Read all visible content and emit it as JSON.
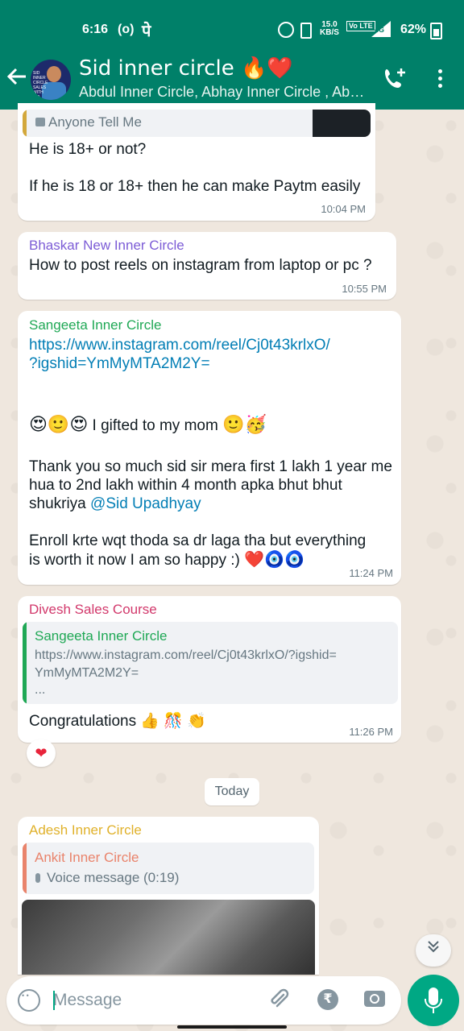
{
  "status_bar": {
    "time": "6:16",
    "record_indicator": "(o)",
    "pe_glyph": "पे",
    "speed": "15.0",
    "speed_unit": "KB/S",
    "volte": "Vo LTE",
    "network": "4G",
    "battery": "62%"
  },
  "header": {
    "title": "Sid inner circle 🔥❤️",
    "subtitle": "Abdul Inner Circle, Abhay Inner Circle , Abhi...",
    "avatar_text": "SID INNER CIRCLE SALES WITH SID"
  },
  "messages": [
    {
      "quote_text": "Anyone Tell Me",
      "lines": [
        "He is 18+ or not?",
        "If he is 18 or 18+ then he can make Paytm easily"
      ],
      "time": "10:04 PM"
    },
    {
      "sender": "Bhaskar New Inner Circle",
      "sender_color": "#7c5cd6",
      "text": "How to post reels on instagram from laptop or pc ?",
      "time": "10:55 PM"
    },
    {
      "sender": "Sangeeta  Inner Circle",
      "sender_color": "#1fa855",
      "link": "https://www.instagram.com/reel/Cj0t43krlxO/?igshid=YmMyMTA2M2Y=",
      "link_line1": "https://www.instagram.com/reel/Cj0t43krlxO/",
      "link_line2": "?igshid=YmMyMTA2M2Y=",
      "emoji_line_prefix": "😍🙂😍",
      "emoji_line_text": " I gifted to my mom ",
      "emoji_line_suffix": "🙂🥳",
      "para1": "Thank you so much sid sir mera first 1 lakh 1 year me hua to 2nd lakh within 4 month apka bhut bhut shukriya",
      "mention": "@Sid Upadhyay",
      "para2": "Enroll krte wqt thoda sa dr laga tha but everything is worth it now I am so happy :)",
      "para2_emoji": "❤️🧿🧿",
      "time": "11:24 PM"
    },
    {
      "sender": "Divesh Sales Course",
      "sender_color": "#d2386b",
      "quote_sender": "Sangeeta  Inner Circle",
      "quote_line1": "https://www.instagram.com/reel/Cj0t43krlxO/?igshid=",
      "quote_line2": "YmMyMTA2M2Y=",
      "quote_line3": "...",
      "text": "Congratulations 👍 🎊 👏",
      "time": "11:26 PM",
      "reaction": "❤"
    },
    {
      "sender": "Adesh Inner Circle",
      "sender_color": "#e0b12a",
      "quote_sender": "Ankit Inner Circle",
      "quote_text": "Voice message (0:19)"
    }
  ],
  "date_divider": "Today",
  "composer": {
    "placeholder": "Message",
    "rupee": "₹"
  },
  "colors": {
    "header_green": "#008069",
    "accent_green": "#00a884",
    "chat_bg": "#efe7de"
  }
}
